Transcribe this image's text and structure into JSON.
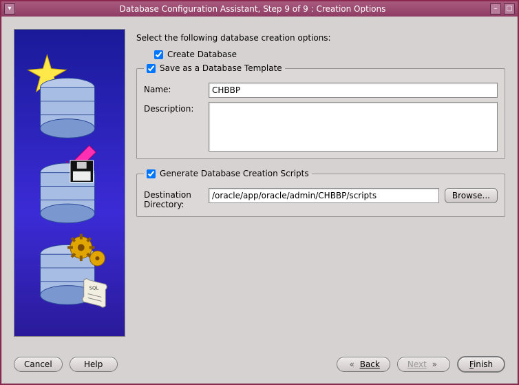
{
  "title": "Database Configuration Assistant, Step 9 of 9 : Creation Options",
  "titlebar": {
    "minimize_icon": "–",
    "maximize_icon": "▢",
    "menu_icon": "▾"
  },
  "instruction": "Select the following database creation options:",
  "options": {
    "create_db": {
      "label": "Create Database",
      "checked": true
    },
    "save_template": {
      "label": "Save as a Database Template",
      "checked": true,
      "fields": {
        "name_label": "Name:",
        "name_value": "CHBBP",
        "desc_label": "Description:",
        "desc_value": ""
      }
    },
    "gen_scripts": {
      "label": "Generate Database Creation Scripts",
      "checked": true,
      "fields": {
        "dest_label_line1": "Destination",
        "dest_label_line2": "Directory:",
        "dest_value": "/oracle/app/oracle/admin/CHBBP/scripts",
        "browse_label": "Browse..."
      }
    }
  },
  "footer": {
    "cancel": "Cancel",
    "help": "Help",
    "back": "Back",
    "next": "Next",
    "finish": "Finish"
  }
}
